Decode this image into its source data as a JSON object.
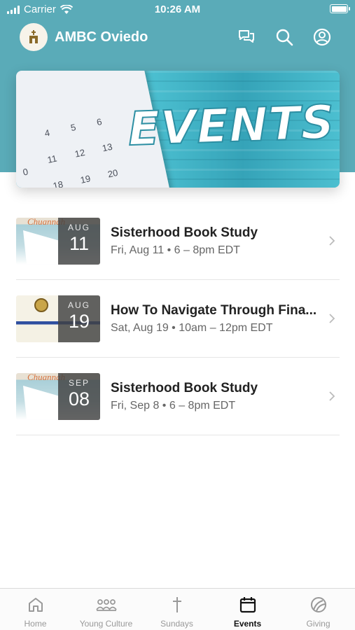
{
  "status_bar": {
    "carrier": "Carrier",
    "time": "10:26 AM"
  },
  "header": {
    "title": "AMBC Oviedo",
    "icons": [
      "chat-icon",
      "search-icon",
      "profile-icon"
    ]
  },
  "banner": {
    "word": "EVENTS",
    "calendar_numbers": [
      "4",
      "5",
      "6",
      "11",
      "12",
      "13",
      "18",
      "19",
      "20",
      "0"
    ]
  },
  "events": [
    {
      "month": "AUG",
      "day": "11",
      "title": "Sisterhood Book Study",
      "meta": "Fri, Aug 11 • 6 – 8pm EDT"
    },
    {
      "month": "AUG",
      "day": "19",
      "title": "How To Navigate Through Fina...",
      "meta": "Sat, Aug 19 • 10am – 12pm EDT"
    },
    {
      "month": "SEP",
      "day": "08",
      "title": "Sisterhood Book Study",
      "meta": "Fri, Sep 8 • 6 – 8pm EDT"
    }
  ],
  "tabs": [
    {
      "label": "Home",
      "icon": "home-icon"
    },
    {
      "label": "Young Culture",
      "icon": "group-icon"
    },
    {
      "label": "Sundays",
      "icon": "cross-icon"
    },
    {
      "label": "Events",
      "icon": "calendar-icon",
      "active": true
    },
    {
      "label": "Giving",
      "icon": "giving-icon"
    }
  ],
  "colors": {
    "accent": "#5aabb8",
    "active_tab": "#111111",
    "inactive_tab": "#999999"
  }
}
